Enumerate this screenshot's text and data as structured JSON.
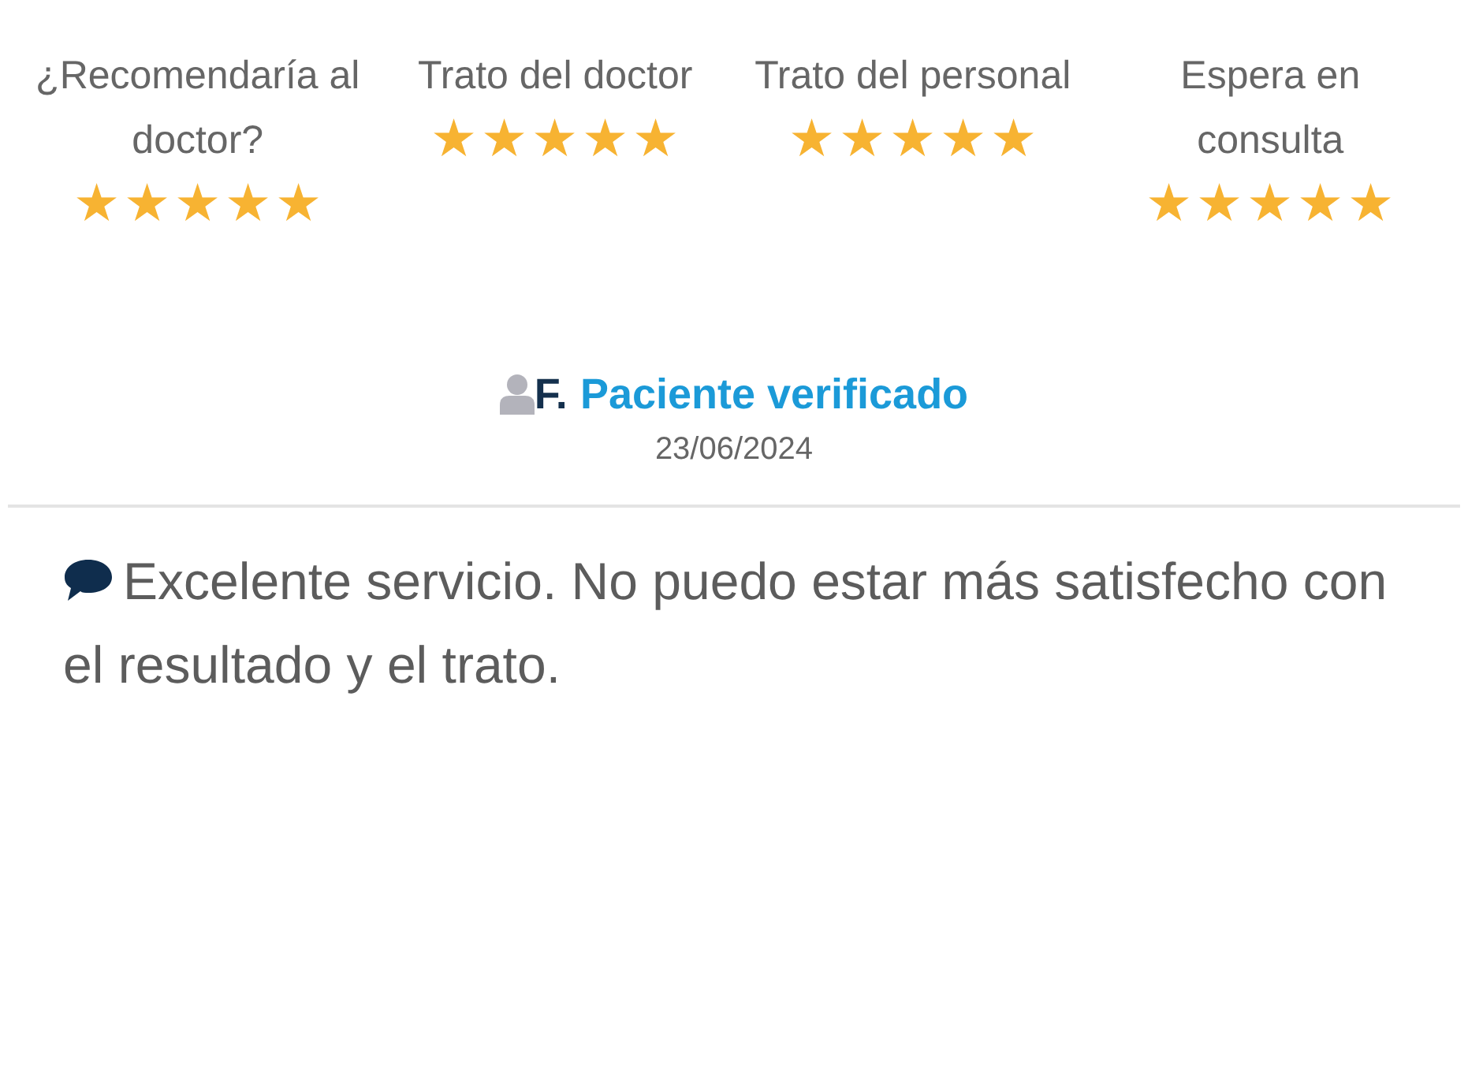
{
  "ratings": [
    {
      "label": "¿Recomendaría al doctor?",
      "stars": 5
    },
    {
      "label": "Trato del doctor",
      "stars": 5
    },
    {
      "label": "Trato del personal",
      "stars": 5
    },
    {
      "label": "Espera en consulta",
      "stars": 5
    }
  ],
  "reviewer": {
    "initial": "F.",
    "verified_label": "Paciente verificado",
    "date": "23/06/2024"
  },
  "comment": "Excelente servicio. No puedo estar más satisfecho con el resultado y el trato."
}
